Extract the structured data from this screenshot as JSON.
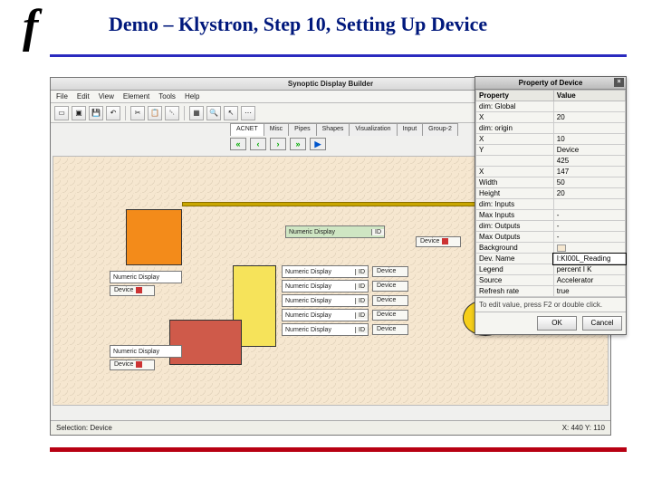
{
  "slide": {
    "logo": "f",
    "title": "Demo – Klystron, Step 10, Setting Up Device"
  },
  "app": {
    "title": "Synoptic Display Builder",
    "menus": [
      "File",
      "Edit",
      "View",
      "Element",
      "Tools",
      "Help"
    ],
    "tabs": [
      "ACNET",
      "Misc",
      "Pipes",
      "Shapes",
      "Visualization",
      "Input",
      "Group-2"
    ],
    "nav": {
      "left_fast": "«",
      "left": "‹",
      "right": "›",
      "right_fast": "»",
      "play": "▶"
    },
    "widgets": {
      "numeric_display": "Numeric Display",
      "device": "Device",
      "id_tag": "ID"
    },
    "rows": [
      {
        "label": "Numeric Display",
        "tag": "ID",
        "dev": "Device"
      },
      {
        "label": "Numeric Display",
        "tag": "ID",
        "dev": "Device"
      },
      {
        "label": "Numeric Display",
        "tag": "ID",
        "dev": "Device"
      },
      {
        "label": "Numeric Display",
        "tag": "ID",
        "dev": "Device"
      },
      {
        "label": "Numeric Display",
        "tag": "ID",
        "dev": "Device"
      }
    ],
    "status": {
      "selection_label": "Selection:",
      "selection_value": "Device",
      "coords": "X: 440    Y: 110"
    }
  },
  "prop": {
    "title": "Property of Device",
    "columns": [
      "Property",
      "Value"
    ],
    "rows": [
      {
        "k": "dim: Global",
        "v": ""
      },
      {
        "k": "   X",
        "v": "20"
      },
      {
        "k": "dim: origin",
        "v": ""
      },
      {
        "k": "   X",
        "v": "10"
      },
      {
        "k": "   Y",
        "v": "Device"
      },
      {
        "k": "   ",
        "v": "425"
      },
      {
        "k": "   X",
        "v": "147"
      },
      {
        "k": "Width",
        "v": "50"
      },
      {
        "k": "Height",
        "v": "20"
      },
      {
        "k": "dim: Inputs",
        "v": ""
      },
      {
        "k": "Max Inputs",
        "v": "-"
      },
      {
        "k": "dim: Outputs",
        "v": "-"
      },
      {
        "k": "Max Outputs",
        "v": "-"
      },
      {
        "k": "Background",
        "v": "__color__"
      },
      {
        "k": "Dev. Name",
        "v": "I:KI00L_Reading",
        "edit": true
      },
      {
        "k": "Legend",
        "v": "percent I K"
      },
      {
        "k": "Source",
        "v": "Accelerator"
      },
      {
        "k": "Refresh rate",
        "v": "true"
      }
    ],
    "hint": "To edit value, press F2 or double click.",
    "ok": "OK",
    "cancel": "Cancel"
  }
}
